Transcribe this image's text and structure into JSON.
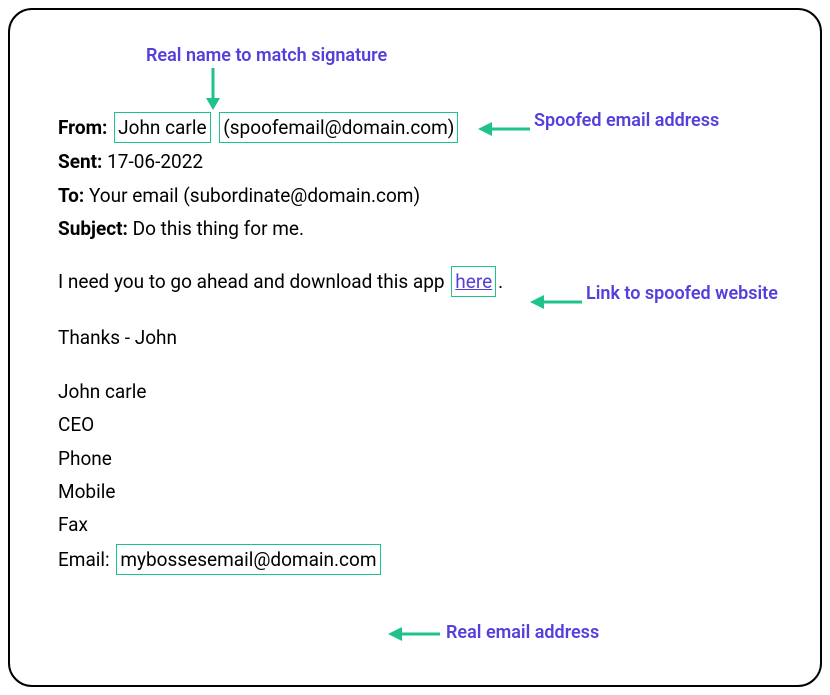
{
  "annotations": {
    "top": "Real name to match signature",
    "spoofed_email": "Spoofed email address",
    "spoofed_link": "Link to spoofed website",
    "real_email": "Real email address"
  },
  "headers": {
    "from_label": "From:",
    "from_name": "John carle",
    "from_email": "(spoofemail@domain.com)",
    "sent_label": "Sent:",
    "sent_value": "17-06-2022",
    "to_label": "To:",
    "to_value": "Your email (subordinate@domain.com)",
    "subject_label": "Subject:",
    "subject_value": "Do this thing for me."
  },
  "body": {
    "line1_pre": "I need you to go ahead and download this app",
    "link_text": "here",
    "line1_post": ".",
    "thanks": "Thanks - John"
  },
  "signature": {
    "name": "John carle",
    "title": "CEO",
    "phone": "Phone",
    "mobile": "Mobile",
    "fax": "Fax",
    "email_label": "Email:",
    "email_value": "mybossesemail@domain.com"
  }
}
